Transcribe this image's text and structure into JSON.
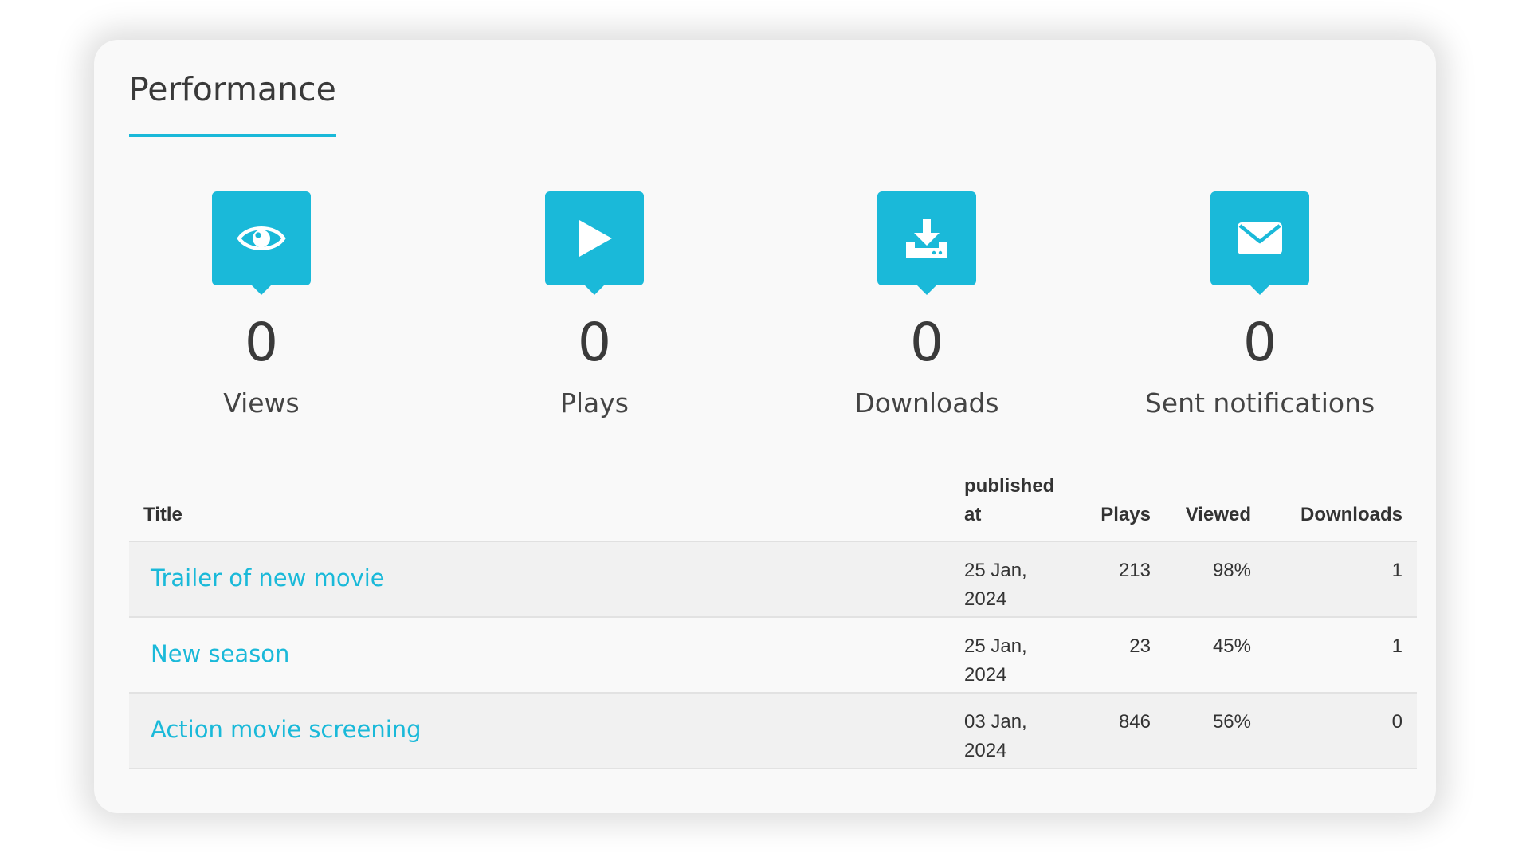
{
  "title": "Performance",
  "colors": {
    "accent": "#1ab9d9",
    "text": "#3a3a3a"
  },
  "stats": [
    {
      "icon": "eye-icon",
      "value": "0",
      "label": "Views"
    },
    {
      "icon": "play-icon",
      "value": "0",
      "label": "Plays"
    },
    {
      "icon": "download-icon",
      "value": "0",
      "label": "Downloads"
    },
    {
      "icon": "envelope-icon",
      "value": "0",
      "label": "Sent notifications"
    }
  ],
  "table": {
    "headers": {
      "title": "Title",
      "published": "published at",
      "plays": "Plays",
      "viewed": "Viewed",
      "downloads": "Downloads"
    },
    "rows": [
      {
        "title": "Trailer of new movie",
        "published": "25 Jan, 2024",
        "plays": "213",
        "viewed": "98%",
        "downloads": "1"
      },
      {
        "title": "New season",
        "published": "25 Jan, 2024",
        "plays": "23",
        "viewed": "45%",
        "downloads": "1"
      },
      {
        "title": "Action movie screening",
        "published": "03 Jan, 2024",
        "plays": "846",
        "viewed": "56%",
        "downloads": "0"
      }
    ]
  }
}
